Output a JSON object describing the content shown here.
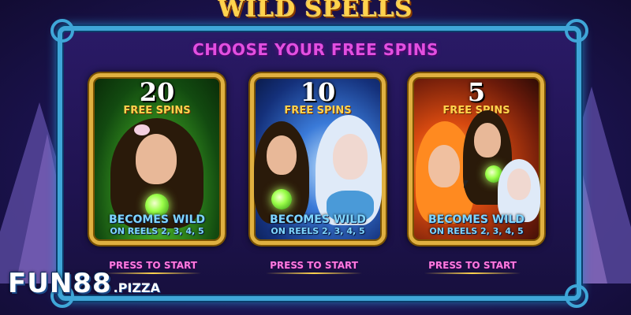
{
  "game": {
    "logo_text": "WILD SPELLS",
    "heading": "CHOOSE YOUR FREE SPINS"
  },
  "options": [
    {
      "count": "20",
      "label": "FREE SPINS",
      "wild_line1": "BECOMES WILD",
      "wild_line2": "ON REELS 2, 3, 4, 5",
      "action": "PRESS TO START",
      "theme_color": "#3a9a20"
    },
    {
      "count": "10",
      "label": "FREE SPINS",
      "wild_line1": "BECOMES WILD",
      "wild_line2": "ON REELS 2, 3, 4, 5",
      "action": "PRESS TO START",
      "theme_color": "#3a7ad8"
    },
    {
      "count": "5",
      "label": "FREE SPINS",
      "wild_line1": "BECOMES WILD",
      "wild_line2": "ON REELS 2, 3, 4, 5",
      "action": "PRESS TO START",
      "theme_color": "#d84a10"
    }
  ],
  "watermark": {
    "main": "FUN88",
    "sub": ".PIZZA"
  },
  "colors": {
    "frame": "#3fa6d8",
    "card_border": "#e0b040",
    "heading": "#e24fe0",
    "gold_text": "#ffd34d",
    "wild_text": "#7fd6ff",
    "press_text": "#ff7adf"
  }
}
